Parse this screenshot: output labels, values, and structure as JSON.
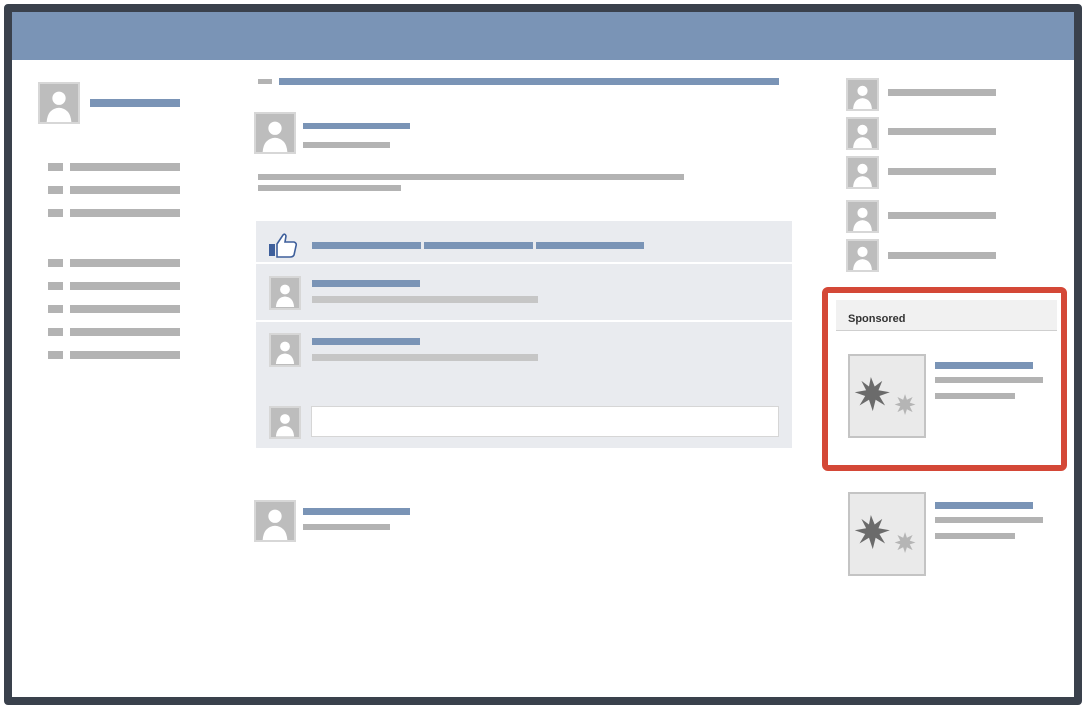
{
  "sponsored": {
    "label": "Sponsored"
  },
  "colors": {
    "frame": "#3a414c",
    "topbar": "#7a94b6",
    "placeholder_blue": "#7a94b6",
    "placeholder_gray": "#b3b3b3",
    "highlight": "#d44837",
    "panel": "#e9ebef"
  },
  "icons": {
    "like": "thumbs-up-icon",
    "avatar": "user-silhouette-icon",
    "ad_image": "starburst-icon"
  }
}
